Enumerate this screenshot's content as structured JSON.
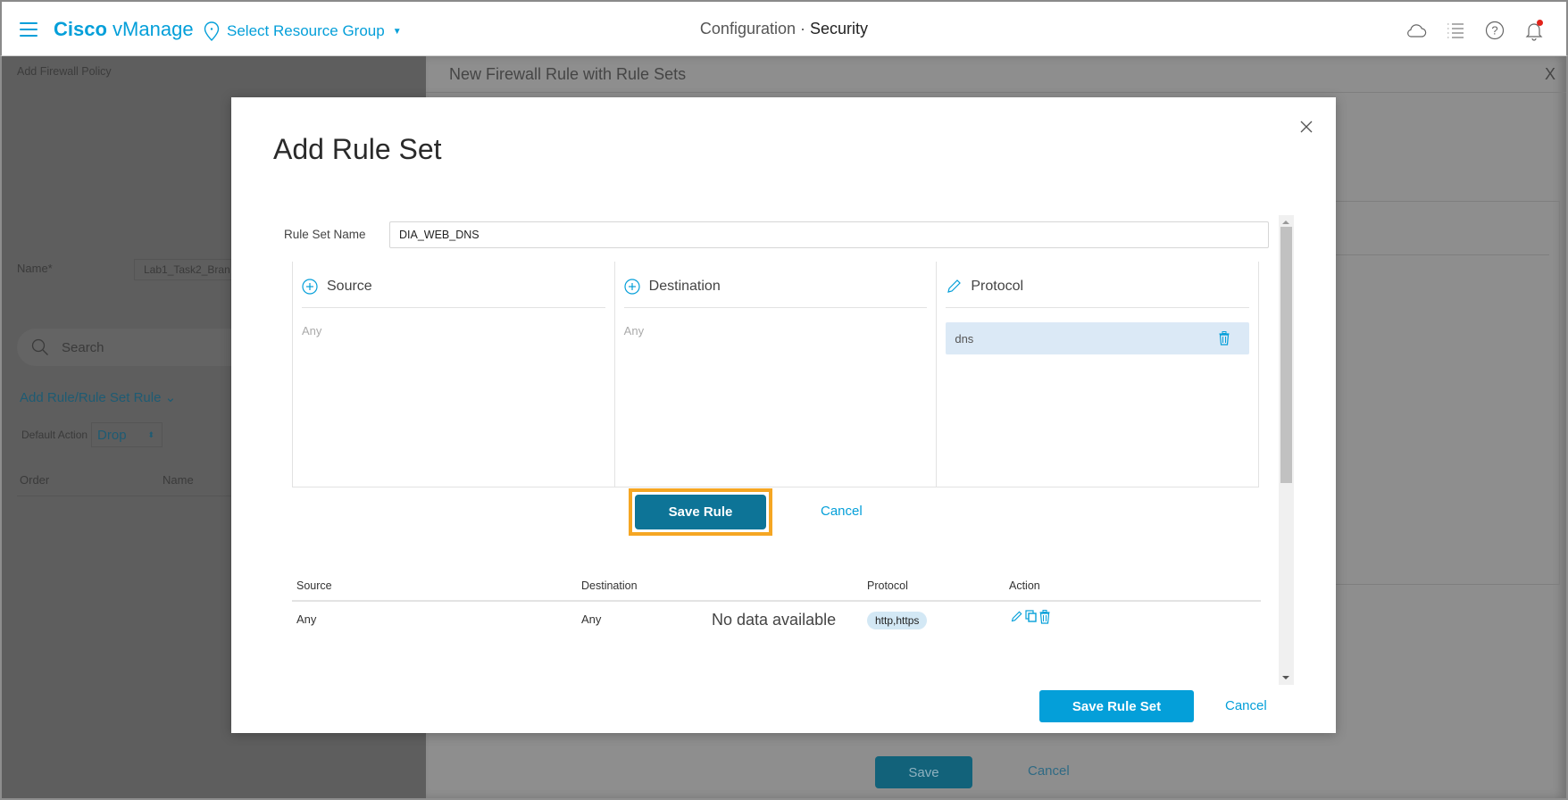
{
  "header": {
    "brand_bold": "Cisco",
    "brand_light": "vManage",
    "resource_group": "Select Resource Group",
    "breadcrumb_parent": "Configuration",
    "breadcrumb_separator": "·",
    "breadcrumb_current": "Security",
    "icons": [
      "cloud-icon",
      "task-list-icon",
      "help-icon",
      "notifications-bell-icon"
    ]
  },
  "background_page": {
    "title": "Add Firewall Policy",
    "name_label": "Name*",
    "name_value": "Lab1_Task2_Bran",
    "search_placeholder": "Search",
    "add_rule_label": "Add Rule/Rule Set Rule",
    "default_action_label": "Default Action",
    "default_action_value": "Drop",
    "table_columns": [
      "Order",
      "Name"
    ],
    "panel_title": "New Firewall Rule with Rule Sets",
    "panel_close": "X",
    "save_label": "Save",
    "cancel_label": "Cancel"
  },
  "modal": {
    "title": "Add Rule Set",
    "rule_set_name_label": "Rule Set Name",
    "rule_set_name_value": "DIA_WEB_DNS",
    "columns": [
      {
        "label": "Source",
        "icon": "add-circle-icon",
        "value": "Any"
      },
      {
        "label": "Destination",
        "icon": "add-circle-icon",
        "value": "Any"
      },
      {
        "label": "Protocol",
        "icon": "pencil-icon",
        "value": "dns"
      }
    ],
    "save_rule_label": "Save Rule",
    "cancel_rule_label": "Cancel",
    "table": {
      "headers": [
        "Source",
        "Destination",
        "Protocol",
        "Action"
      ],
      "rows": [
        {
          "source": "Any",
          "destination": "Any",
          "note": "No data available",
          "protocol": "http,https",
          "actions": [
            "edit-icon",
            "copy-icon",
            "delete-icon"
          ]
        }
      ]
    },
    "save_rule_set_label": "Save Rule Set",
    "cancel_label": "Cancel"
  },
  "colors": {
    "accent": "#049fd9",
    "save_rule_bg": "#0d7497",
    "highlight": "#f5a623",
    "chip_bg": "#dbe9f6",
    "notification_dot": "#e2231a"
  }
}
